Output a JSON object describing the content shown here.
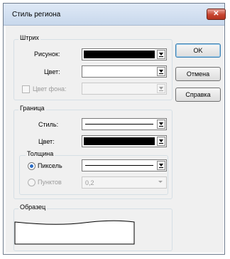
{
  "dialog": {
    "title": "Стиль региона",
    "close_label": "✕"
  },
  "stroke_group": {
    "legend": "Штрих",
    "pattern_label": "Рисунок:",
    "color_label": "Цвет:",
    "bg_color_label": "Цвет фона:",
    "pattern_color": "#000000",
    "color_value": "#ffffff",
    "bg_color_enabled": false
  },
  "border_group": {
    "legend": "Граница",
    "style_label": "Стиль:",
    "color_label": "Цвет:",
    "color_value": "#000000",
    "thickness": {
      "legend": "Толщина",
      "pixel_label": "Пиксель",
      "points_label": "Пунктов",
      "points_value": "0,2",
      "selected": "pixel"
    }
  },
  "sample_group": {
    "legend": "Образец"
  },
  "buttons": {
    "ok": "OK",
    "cancel": "Отмена",
    "help": "Справка"
  }
}
